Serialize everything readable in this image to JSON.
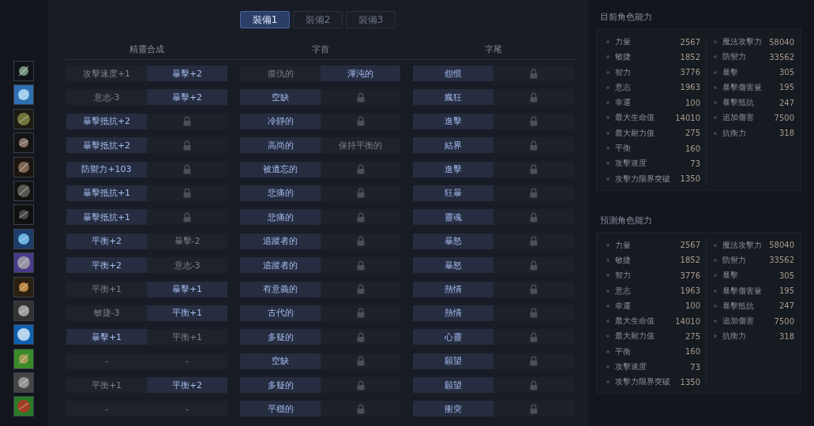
{
  "tabs": [
    {
      "label": "裝備1",
      "selected": true
    },
    {
      "label": "裝備2",
      "selected": false
    },
    {
      "label": "裝備3",
      "selected": false
    }
  ],
  "columns": [
    "精靈合成",
    "字首",
    "字尾"
  ],
  "rows": [
    {
      "cells": [
        {
          "kind": "inactive",
          "text": "攻擊速度+1"
        },
        {
          "kind": "active",
          "text": "暴擊+2"
        },
        {
          "kind": "inactive",
          "text": "復仇的"
        },
        {
          "kind": "active",
          "text": "渾沌的"
        },
        {
          "kind": "active",
          "text": "怨恨"
        },
        {
          "kind": "locked"
        }
      ]
    },
    {
      "cells": [
        {
          "kind": "inactive",
          "text": "意志-3"
        },
        {
          "kind": "active",
          "text": "暴擊+2"
        },
        {
          "kind": "active",
          "text": "空缺"
        },
        {
          "kind": "locked"
        },
        {
          "kind": "active",
          "text": "瘋狂"
        },
        {
          "kind": "locked"
        }
      ]
    },
    {
      "cells": [
        {
          "kind": "active",
          "text": "暴擊抵抗+2"
        },
        {
          "kind": "locked"
        },
        {
          "kind": "active",
          "text": "冷靜的"
        },
        {
          "kind": "locked"
        },
        {
          "kind": "active",
          "text": "進擊"
        },
        {
          "kind": "locked"
        }
      ]
    },
    {
      "cells": [
        {
          "kind": "active",
          "text": "暴擊抵抗+2"
        },
        {
          "kind": "locked"
        },
        {
          "kind": "active",
          "text": "高尚的"
        },
        {
          "kind": "inactive",
          "text": "保持平衡的"
        },
        {
          "kind": "active",
          "text": "結界"
        },
        {
          "kind": "locked"
        }
      ]
    },
    {
      "cells": [
        {
          "kind": "active",
          "text": "防禦力+103"
        },
        {
          "kind": "locked"
        },
        {
          "kind": "active",
          "text": "被遺忘的"
        },
        {
          "kind": "locked"
        },
        {
          "kind": "active",
          "text": "進擊"
        },
        {
          "kind": "locked"
        }
      ]
    },
    {
      "cells": [
        {
          "kind": "active",
          "text": "暴擊抵抗+1"
        },
        {
          "kind": "locked"
        },
        {
          "kind": "active",
          "text": "悲痛的"
        },
        {
          "kind": "locked"
        },
        {
          "kind": "active",
          "text": "狂暴"
        },
        {
          "kind": "locked"
        }
      ]
    },
    {
      "cells": [
        {
          "kind": "active",
          "text": "暴擊抵抗+1"
        },
        {
          "kind": "locked"
        },
        {
          "kind": "active",
          "text": "悲痛的"
        },
        {
          "kind": "locked"
        },
        {
          "kind": "active",
          "text": "靈魂"
        },
        {
          "kind": "locked"
        }
      ]
    },
    {
      "cells": [
        {
          "kind": "active",
          "text": "平衡+2"
        },
        {
          "kind": "inactive",
          "text": "暴擊-2"
        },
        {
          "kind": "active",
          "text": "追蹤者的"
        },
        {
          "kind": "locked"
        },
        {
          "kind": "active",
          "text": "暴怒"
        },
        {
          "kind": "locked"
        }
      ]
    },
    {
      "cells": [
        {
          "kind": "active",
          "text": "平衡+2"
        },
        {
          "kind": "inactive",
          "text": "意志-3"
        },
        {
          "kind": "active",
          "text": "追蹤者的"
        },
        {
          "kind": "locked"
        },
        {
          "kind": "active",
          "text": "暴怒"
        },
        {
          "kind": "locked"
        }
      ]
    },
    {
      "cells": [
        {
          "kind": "inactive",
          "text": "平衡+1"
        },
        {
          "kind": "active",
          "text": "暴擊+1"
        },
        {
          "kind": "active",
          "text": "有意義的"
        },
        {
          "kind": "locked"
        },
        {
          "kind": "active",
          "text": "熱情"
        },
        {
          "kind": "locked"
        }
      ]
    },
    {
      "cells": [
        {
          "kind": "inactive",
          "text": "敏捷-3"
        },
        {
          "kind": "active",
          "text": "平衡+1"
        },
        {
          "kind": "active",
          "text": "古代的"
        },
        {
          "kind": "locked"
        },
        {
          "kind": "active",
          "text": "熱情"
        },
        {
          "kind": "locked"
        }
      ]
    },
    {
      "cells": [
        {
          "kind": "active",
          "text": "暴擊+1"
        },
        {
          "kind": "inactive",
          "text": "平衡+1"
        },
        {
          "kind": "active",
          "text": "多疑的"
        },
        {
          "kind": "locked"
        },
        {
          "kind": "active",
          "text": "心靈"
        },
        {
          "kind": "locked"
        }
      ]
    },
    {
      "cells": [
        {
          "kind": "inactive",
          "text": "-"
        },
        {
          "kind": "inactive",
          "text": "-"
        },
        {
          "kind": "active",
          "text": "空缺"
        },
        {
          "kind": "locked"
        },
        {
          "kind": "active",
          "text": "願望"
        },
        {
          "kind": "locked"
        }
      ]
    },
    {
      "cells": [
        {
          "kind": "inactive",
          "text": "平衡+1"
        },
        {
          "kind": "active",
          "text": "平衡+2"
        },
        {
          "kind": "active",
          "text": "多疑的"
        },
        {
          "kind": "locked"
        },
        {
          "kind": "active",
          "text": "願望"
        },
        {
          "kind": "locked"
        }
      ]
    },
    {
      "cells": [
        {
          "kind": "inactive",
          "text": "-"
        },
        {
          "kind": "inactive",
          "text": "-"
        },
        {
          "kind": "active",
          "text": "平穩的"
        },
        {
          "kind": "locked"
        },
        {
          "kind": "active",
          "text": "衝突"
        },
        {
          "kind": "locked"
        }
      ]
    }
  ],
  "panels": [
    {
      "title": "目前角色能力",
      "left": [
        {
          "name": "力量",
          "value": "2567"
        },
        {
          "name": "敏捷",
          "value": "1852"
        },
        {
          "name": "智力",
          "value": "3776"
        },
        {
          "name": "意志",
          "value": "1963"
        },
        {
          "name": "幸運",
          "value": "100"
        },
        {
          "name": "最大生命值",
          "value": "14010"
        },
        {
          "name": "最大耐力值",
          "value": "275"
        },
        {
          "name": "平衡",
          "value": "160"
        },
        {
          "name": "攻擊速度",
          "value": "73"
        },
        {
          "name": "攻擊力限界突破",
          "value": "1350"
        }
      ],
      "right": [
        {
          "name": "魔法攻擊力",
          "value": "58040"
        },
        {
          "name": "防禦力",
          "value": "33562"
        },
        {
          "name": "暴擊",
          "value": "305"
        },
        {
          "name": "暴擊傷害量",
          "value": "195"
        },
        {
          "name": "暴擊抵抗",
          "value": "247"
        },
        {
          "name": "追加傷害",
          "value": "7500"
        },
        {
          "name": "抗衡力",
          "value": "318"
        }
      ]
    },
    {
      "title": "預測角色能力",
      "left": [
        {
          "name": "力量",
          "value": "2567"
        },
        {
          "name": "敏捷",
          "value": "1852"
        },
        {
          "name": "智力",
          "value": "3776"
        },
        {
          "name": "意志",
          "value": "1963"
        },
        {
          "name": "幸運",
          "value": "100"
        },
        {
          "name": "最大生命值",
          "value": "14010"
        },
        {
          "name": "最大耐力值",
          "value": "275"
        },
        {
          "name": "平衡",
          "value": "160"
        },
        {
          "name": "攻擊速度",
          "value": "73"
        },
        {
          "name": "攻擊力限界突破",
          "value": "1350"
        }
      ],
      "right": [
        {
          "name": "魔法攻擊力",
          "value": "58040"
        },
        {
          "name": "防禦力",
          "value": "33562"
        },
        {
          "name": "暴擊",
          "value": "305"
        },
        {
          "name": "暴擊傷害量",
          "value": "195"
        },
        {
          "name": "暴擊抵抗",
          "value": "247"
        },
        {
          "name": "追加傷害",
          "value": "7500"
        },
        {
          "name": "抗衡力",
          "value": "318"
        }
      ]
    }
  ]
}
